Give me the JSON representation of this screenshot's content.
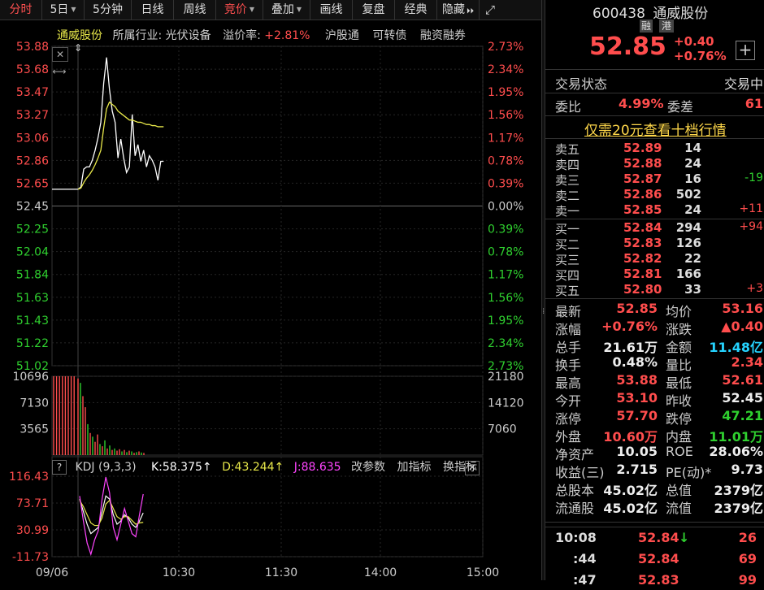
{
  "toolbar": {
    "items": [
      "分时",
      "5日",
      "5分钟",
      "日线",
      "周线",
      "竞价",
      "叠加",
      "画线",
      "复盘",
      "经典",
      "隐藏"
    ],
    "active_index": 5,
    "dropdown_marker": "▼",
    "more_icon": "⏵⏵",
    "expand_icon": "⤢"
  },
  "chart_header": {
    "stock_name": "通威股份",
    "industry": "所属行业: 光伏设备",
    "premium_label": "溢价率:",
    "premium_value": "+2.81%",
    "tags": [
      "沪股通",
      "可转债",
      "融资融券"
    ]
  },
  "chart_data": [
    {
      "type": "line",
      "title": "",
      "y_labels_left": [
        "53.88",
        "53.68",
        "53.47",
        "53.27",
        "53.06",
        "52.86",
        "52.65",
        "52.45",
        "52.25",
        "52.04",
        "51.84",
        "51.63",
        "51.43",
        "51.22",
        "51.02"
      ],
      "y_labels_right": [
        "2.73%",
        "2.34%",
        "1.95%",
        "1.56%",
        "1.17%",
        "0.78%",
        "0.39%",
        "0.00%",
        "0.39%",
        "0.78%",
        "1.17%",
        "1.56%",
        "1.95%",
        "2.34%",
        "2.73%"
      ],
      "ylim": [
        51.02,
        53.88
      ],
      "prev_close": 52.45,
      "x_labels": [
        "09/06",
        "10:30",
        "11:30",
        "14:00",
        "15:00"
      ],
      "series": [
        {
          "values": [
            52.6,
            52.62,
            52.78,
            52.8,
            52.8,
            52.86,
            52.95,
            53.06,
            53.2,
            53.55,
            53.78,
            53.5,
            53.3,
            53.2,
            52.88,
            53.05,
            52.88,
            52.75,
            52.8,
            53.27,
            52.9,
            53.0,
            52.85,
            52.95,
            52.8,
            52.9,
            52.86,
            52.8,
            52.68,
            52.85,
            52.85
          ],
          "color": "#ffffff"
        },
        {
          "values": [
            52.6,
            52.61,
            52.66,
            52.7,
            52.73,
            52.77,
            52.82,
            52.88,
            52.95,
            53.15,
            53.32,
            53.38,
            53.36,
            53.34,
            53.3,
            53.28,
            53.26,
            53.24,
            53.22,
            53.22,
            53.21,
            53.2,
            53.2,
            53.19,
            53.18,
            53.18,
            53.17,
            53.17,
            53.16,
            53.16,
            53.16
          ],
          "color": "#e8e84a"
        }
      ]
    },
    {
      "type": "bar",
      "title": "",
      "y_labels_left": [
        "10696",
        "7130",
        "3565"
      ],
      "y_labels_right": [
        "21180",
        "14120",
        "7060"
      ],
      "ylim": [
        0,
        10696
      ],
      "values": [
        10696,
        10696,
        10696,
        10696,
        10696,
        10696,
        10696,
        10696,
        10400,
        9800,
        8000,
        6500,
        4200,
        3000,
        2500,
        1800,
        2800,
        1500,
        1200,
        2000,
        900,
        1300,
        700,
        900,
        600,
        800,
        500,
        700,
        400,
        600,
        500,
        300,
        400,
        500,
        350,
        300
      ],
      "colors": [
        "r",
        "r",
        "r",
        "r",
        "r",
        "r",
        "r",
        "r",
        "r",
        "g",
        "r",
        "r",
        "g",
        "r",
        "g",
        "r",
        "r",
        "g",
        "r",
        "g",
        "r",
        "g",
        "r",
        "g",
        "r",
        "r",
        "g",
        "r",
        "g",
        "r",
        "g",
        "r",
        "g",
        "r",
        "g",
        "r"
      ]
    },
    {
      "type": "line",
      "title": "",
      "y_labels": [
        "116.43",
        "73.71",
        "30.99",
        "-11.73"
      ],
      "ylim": [
        -11.73,
        116.43
      ],
      "series": [
        {
          "name": "K:58.375↑",
          "values": [
            80,
            60,
            40,
            25,
            30,
            35,
            60,
            85,
            80,
            55,
            40,
            45,
            55,
            50,
            40,
            35,
            45,
            58
          ],
          "color": "#ffffff"
        },
        {
          "name": "D:43.244↑",
          "values": [
            78,
            68,
            55,
            42,
            38,
            38,
            50,
            72,
            78,
            65,
            52,
            48,
            52,
            52,
            46,
            40,
            42,
            43
          ],
          "color": "#e8e84a"
        },
        {
          "name": "J:88.635",
          "values": [
            85,
            45,
            10,
            -8,
            15,
            30,
            80,
            115,
            90,
            35,
            15,
            40,
            65,
            45,
            25,
            20,
            55,
            88
          ],
          "color": "#ff45ff"
        }
      ]
    }
  ],
  "kdj_bar": {
    "question": "?",
    "label": "KDJ (9,3,3)",
    "k": "K:58.375↑",
    "d": "D:43.244↑",
    "j": "J:88.635",
    "btn1": "改参数",
    "btn2": "加指标",
    "btn3": "换指标",
    "close": "✕"
  },
  "quote": {
    "code": "600438",
    "name": "通威股份",
    "price": "52.85",
    "badge1": "融",
    "badge2": "港",
    "change": "+0.40",
    "change_pct": "+0.76%",
    "plus_icon": "+",
    "status_label": "交易状态",
    "status_value": "交易中",
    "weibi_label": "委比",
    "weibi_value": "4.99%",
    "weicha_label": "委差",
    "weicha_value": "61",
    "promo": "仅需20元查看十档行情"
  },
  "order_book": {
    "asks": [
      {
        "label": "卖五",
        "price": "52.89",
        "vol": "14",
        "chg": ""
      },
      {
        "label": "卖四",
        "price": "52.88",
        "vol": "24",
        "chg": ""
      },
      {
        "label": "卖三",
        "price": "52.87",
        "vol": "16",
        "chg": "-19"
      },
      {
        "label": "卖二",
        "price": "52.86",
        "vol": "502",
        "chg": ""
      },
      {
        "label": "卖一",
        "price": "52.85",
        "vol": "24",
        "chg": "+11"
      }
    ],
    "bids": [
      {
        "label": "买一",
        "price": "52.84",
        "vol": "294",
        "chg": "+94"
      },
      {
        "label": "买二",
        "price": "52.83",
        "vol": "126",
        "chg": ""
      },
      {
        "label": "买三",
        "price": "52.82",
        "vol": "22",
        "chg": ""
      },
      {
        "label": "买四",
        "price": "52.81",
        "vol": "166",
        "chg": ""
      },
      {
        "label": "买五",
        "price": "52.80",
        "vol": "33",
        "chg": "+3"
      }
    ]
  },
  "stats": [
    {
      "l1": "最新",
      "v1": "52.85",
      "c1": "red",
      "l2": "均价",
      "v2": "53.16",
      "c2": "red"
    },
    {
      "l1": "涨幅",
      "v1": "+0.76%",
      "c1": "red",
      "l2": "涨跌",
      "v2": "▲0.40",
      "c2": "red"
    },
    {
      "l1": "总手",
      "v1": "21.61万",
      "c1": "white",
      "l2": "金额",
      "v2": "11.48亿",
      "c2": "cyan"
    },
    {
      "l1": "换手",
      "v1": "0.48%",
      "c1": "white",
      "l2": "量比",
      "v2": "2.34",
      "c2": "red"
    },
    {
      "l1": "最高",
      "v1": "53.88",
      "c1": "red",
      "l2": "最低",
      "v2": "52.61",
      "c2": "red"
    },
    {
      "l1": "今开",
      "v1": "53.10",
      "c1": "red",
      "l2": "昨收",
      "v2": "52.45",
      "c2": "white"
    },
    {
      "l1": "涨停",
      "v1": "57.70",
      "c1": "red",
      "l2": "跌停",
      "v2": "47.21",
      "c2": "green"
    },
    {
      "l1": "外盘",
      "v1": "10.60万",
      "c1": "red",
      "l2": "内盘",
      "v2": "11.01万",
      "c2": "green"
    },
    {
      "l1": "净资产",
      "v1": "10.05",
      "c1": "white",
      "l2": "ROE",
      "v2": "28.06%",
      "c2": "white"
    },
    {
      "l1": "收益(三)",
      "v1": "2.715",
      "c1": "white",
      "l2": "PE(动)*",
      "v2": "9.73",
      "c2": "white"
    },
    {
      "l1": "总股本",
      "v1": "45.02亿",
      "c1": "white",
      "l2": "总值",
      "v2": "2379亿",
      "c2": "white"
    },
    {
      "l1": "流通股",
      "v1": "45.02亿",
      "c1": "white",
      "l2": "流值",
      "v2": "2379亿",
      "c2": "white"
    }
  ],
  "trades": [
    {
      "time": "10:08",
      "price": "52.84",
      "arrow": "↓",
      "vol": "26"
    },
    {
      "time": ":44",
      "price": "52.84",
      "arrow": "",
      "vol": "69"
    },
    {
      "time": ":47",
      "price": "52.83",
      "arrow": "",
      "vol": "99"
    }
  ],
  "colors": {
    "red": "#ff4d4d",
    "green": "#2fd02f",
    "yellow": "#e8e84a",
    "magenta": "#ff45ff",
    "cyan": "#25d3ff"
  }
}
